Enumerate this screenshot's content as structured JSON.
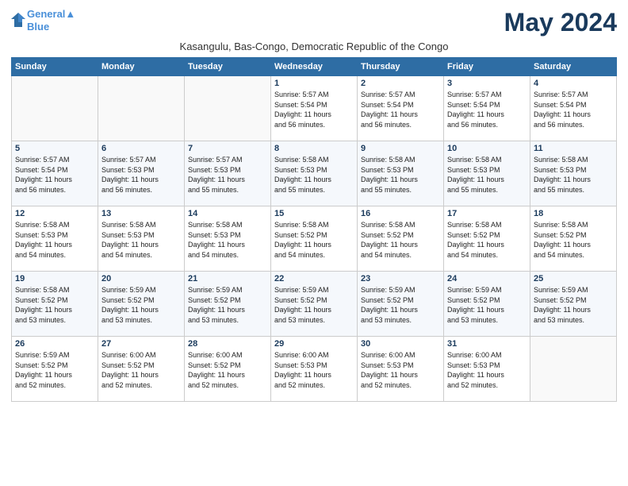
{
  "logo": {
    "line1": "General",
    "line2": "Blue"
  },
  "title": "May 2024",
  "subtitle": "Kasangulu, Bas-Congo, Democratic Republic of the Congo",
  "days_header": [
    "Sunday",
    "Monday",
    "Tuesday",
    "Wednesday",
    "Thursday",
    "Friday",
    "Saturday"
  ],
  "weeks": [
    [
      {
        "day": "",
        "info": ""
      },
      {
        "day": "",
        "info": ""
      },
      {
        "day": "",
        "info": ""
      },
      {
        "day": "1",
        "info": "Sunrise: 5:57 AM\nSunset: 5:54 PM\nDaylight: 11 hours\nand 56 minutes."
      },
      {
        "day": "2",
        "info": "Sunrise: 5:57 AM\nSunset: 5:54 PM\nDaylight: 11 hours\nand 56 minutes."
      },
      {
        "day": "3",
        "info": "Sunrise: 5:57 AM\nSunset: 5:54 PM\nDaylight: 11 hours\nand 56 minutes."
      },
      {
        "day": "4",
        "info": "Sunrise: 5:57 AM\nSunset: 5:54 PM\nDaylight: 11 hours\nand 56 minutes."
      }
    ],
    [
      {
        "day": "5",
        "info": "Sunrise: 5:57 AM\nSunset: 5:54 PM\nDaylight: 11 hours\nand 56 minutes."
      },
      {
        "day": "6",
        "info": "Sunrise: 5:57 AM\nSunset: 5:53 PM\nDaylight: 11 hours\nand 56 minutes."
      },
      {
        "day": "7",
        "info": "Sunrise: 5:57 AM\nSunset: 5:53 PM\nDaylight: 11 hours\nand 55 minutes."
      },
      {
        "day": "8",
        "info": "Sunrise: 5:58 AM\nSunset: 5:53 PM\nDaylight: 11 hours\nand 55 minutes."
      },
      {
        "day": "9",
        "info": "Sunrise: 5:58 AM\nSunset: 5:53 PM\nDaylight: 11 hours\nand 55 minutes."
      },
      {
        "day": "10",
        "info": "Sunrise: 5:58 AM\nSunset: 5:53 PM\nDaylight: 11 hours\nand 55 minutes."
      },
      {
        "day": "11",
        "info": "Sunrise: 5:58 AM\nSunset: 5:53 PM\nDaylight: 11 hours\nand 55 minutes."
      }
    ],
    [
      {
        "day": "12",
        "info": "Sunrise: 5:58 AM\nSunset: 5:53 PM\nDaylight: 11 hours\nand 54 minutes."
      },
      {
        "day": "13",
        "info": "Sunrise: 5:58 AM\nSunset: 5:53 PM\nDaylight: 11 hours\nand 54 minutes."
      },
      {
        "day": "14",
        "info": "Sunrise: 5:58 AM\nSunset: 5:53 PM\nDaylight: 11 hours\nand 54 minutes."
      },
      {
        "day": "15",
        "info": "Sunrise: 5:58 AM\nSunset: 5:52 PM\nDaylight: 11 hours\nand 54 minutes."
      },
      {
        "day": "16",
        "info": "Sunrise: 5:58 AM\nSunset: 5:52 PM\nDaylight: 11 hours\nand 54 minutes."
      },
      {
        "day": "17",
        "info": "Sunrise: 5:58 AM\nSunset: 5:52 PM\nDaylight: 11 hours\nand 54 minutes."
      },
      {
        "day": "18",
        "info": "Sunrise: 5:58 AM\nSunset: 5:52 PM\nDaylight: 11 hours\nand 54 minutes."
      }
    ],
    [
      {
        "day": "19",
        "info": "Sunrise: 5:58 AM\nSunset: 5:52 PM\nDaylight: 11 hours\nand 53 minutes."
      },
      {
        "day": "20",
        "info": "Sunrise: 5:59 AM\nSunset: 5:52 PM\nDaylight: 11 hours\nand 53 minutes."
      },
      {
        "day": "21",
        "info": "Sunrise: 5:59 AM\nSunset: 5:52 PM\nDaylight: 11 hours\nand 53 minutes."
      },
      {
        "day": "22",
        "info": "Sunrise: 5:59 AM\nSunset: 5:52 PM\nDaylight: 11 hours\nand 53 minutes."
      },
      {
        "day": "23",
        "info": "Sunrise: 5:59 AM\nSunset: 5:52 PM\nDaylight: 11 hours\nand 53 minutes."
      },
      {
        "day": "24",
        "info": "Sunrise: 5:59 AM\nSunset: 5:52 PM\nDaylight: 11 hours\nand 53 minutes."
      },
      {
        "day": "25",
        "info": "Sunrise: 5:59 AM\nSunset: 5:52 PM\nDaylight: 11 hours\nand 53 minutes."
      }
    ],
    [
      {
        "day": "26",
        "info": "Sunrise: 5:59 AM\nSunset: 5:52 PM\nDaylight: 11 hours\nand 52 minutes."
      },
      {
        "day": "27",
        "info": "Sunrise: 6:00 AM\nSunset: 5:52 PM\nDaylight: 11 hours\nand 52 minutes."
      },
      {
        "day": "28",
        "info": "Sunrise: 6:00 AM\nSunset: 5:52 PM\nDaylight: 11 hours\nand 52 minutes."
      },
      {
        "day": "29",
        "info": "Sunrise: 6:00 AM\nSunset: 5:53 PM\nDaylight: 11 hours\nand 52 minutes."
      },
      {
        "day": "30",
        "info": "Sunrise: 6:00 AM\nSunset: 5:53 PM\nDaylight: 11 hours\nand 52 minutes."
      },
      {
        "day": "31",
        "info": "Sunrise: 6:00 AM\nSunset: 5:53 PM\nDaylight: 11 hours\nand 52 minutes."
      },
      {
        "day": "",
        "info": ""
      }
    ]
  ]
}
